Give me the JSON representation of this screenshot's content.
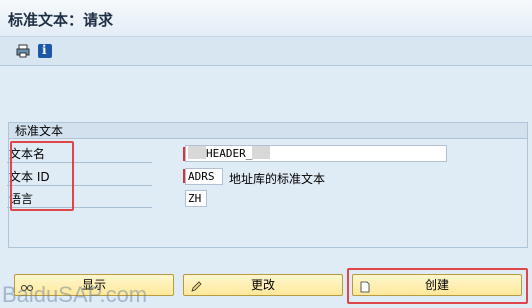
{
  "window": {
    "title": "标准文本：请求"
  },
  "toolbar": {
    "icons": [
      "print-icon",
      "info-icon"
    ]
  },
  "group": {
    "title": "标准文本",
    "fields": [
      {
        "label": "文本名",
        "value_prefix": "",
        "value_mid": "HEADER_",
        "value_suffix": ""
      },
      {
        "label": "文本 ID",
        "value": "ADRS",
        "description": "地址库的标准文本"
      },
      {
        "label": "语言",
        "value": "ZH"
      }
    ]
  },
  "buttons": {
    "display": "显示",
    "change": "更改",
    "create": "创建"
  },
  "watermark": "BaiduSAP.com",
  "colors": {
    "highlight": "#e0454a",
    "button_fill": "#ffe89a",
    "background": "#dfebf5"
  }
}
